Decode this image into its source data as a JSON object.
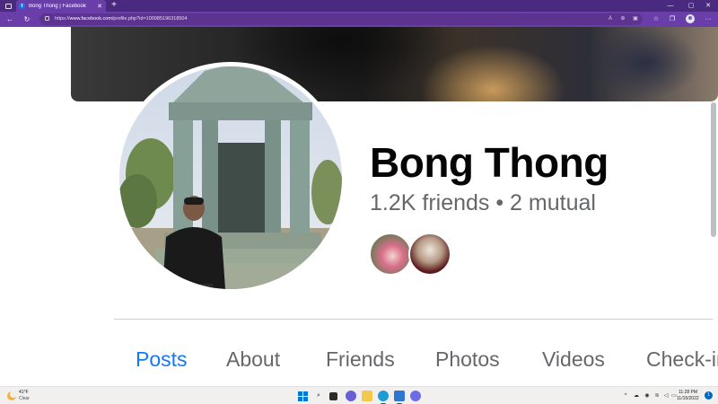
{
  "browser": {
    "tab_title": "Bong Thong | Facebook",
    "tab_favicon": "f",
    "tab_close": "✕",
    "new_tab": "+",
    "url_prefix": "https://",
    "url_host": "www.facebook.com",
    "url_path": "/profile.php?id=100085196318504",
    "window_controls": {
      "minimize": "—",
      "maximize": "▢",
      "close": "✕"
    },
    "icons": [
      "back-icon",
      "refresh-icon",
      "lock-icon",
      "read-aloud-icon",
      "zoom-icon",
      "extensions-icon",
      "favorites-icon",
      "collections-icon",
      "profile-icon",
      "more-icon"
    ]
  },
  "profile": {
    "name": "Bong Thong",
    "friends_line": "1.2K friends • 2 mutual",
    "mutual_friends": [
      "mutual-friend-1",
      "mutual-friend-2"
    ]
  },
  "tabs": [
    {
      "label": "Posts",
      "active": true
    },
    {
      "label": "About",
      "active": false
    },
    {
      "label": "Friends",
      "active": false
    },
    {
      "label": "Photos",
      "active": false
    },
    {
      "label": "Videos",
      "active": false
    },
    {
      "label": "Check-ins",
      "active": false
    }
  ],
  "colors": {
    "accent": "#1877f2",
    "browser_frame": "#6a3ea8",
    "text_primary": "#050505",
    "text_secondary": "#65676b"
  },
  "taskbar": {
    "weather_temp": "41°F",
    "weather_condition": "Clear",
    "time": "11:28 PM",
    "date": "11/15/2022",
    "notification_count": "1",
    "apps": [
      "start-icon",
      "search-icon",
      "task-view-icon",
      "chat-icon",
      "file-explorer-icon",
      "edge-icon",
      "store-icon",
      "messenger-icon"
    ]
  }
}
